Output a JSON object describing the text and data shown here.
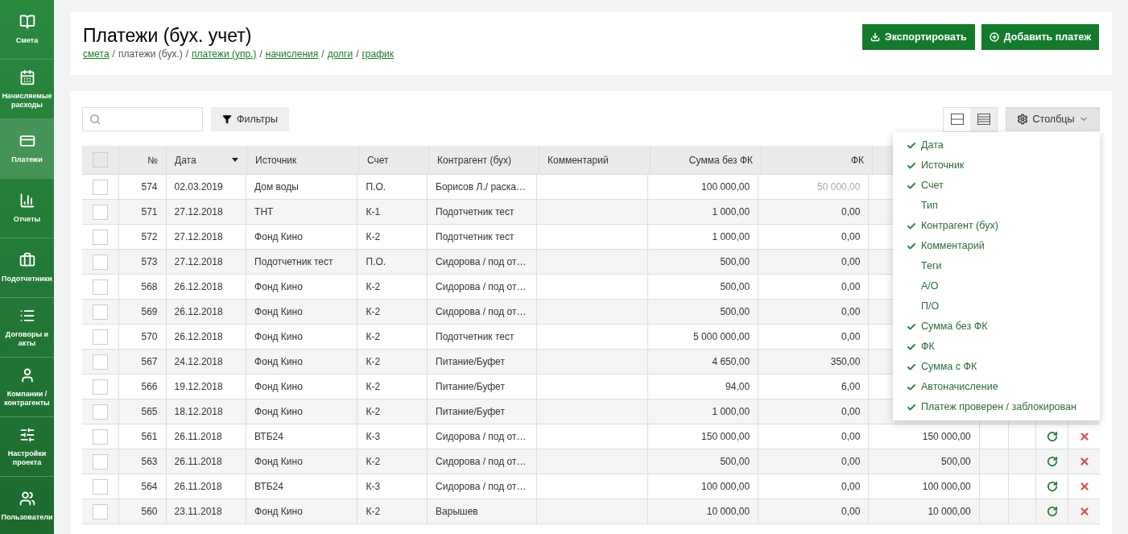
{
  "sidebar": {
    "items": [
      {
        "label": "Смета",
        "selected": false
      },
      {
        "label": "Начисляемые расходы",
        "selected": false
      },
      {
        "label": "Платежи",
        "selected": true
      },
      {
        "label": "Отчеты",
        "selected": false
      },
      {
        "label": "Подотчетники",
        "selected": false
      },
      {
        "label": "Договоры и акты",
        "selected": false
      },
      {
        "label": "Компании / контрагенты",
        "selected": false
      },
      {
        "label": "Настройки проекта",
        "selected": false
      },
      {
        "label": "Пользователи",
        "selected": false
      }
    ]
  },
  "header": {
    "title": "Платежи (бух. учет)",
    "breadcrumbs": [
      {
        "kind": "link",
        "label": "смета"
      },
      {
        "kind": "separator",
        "label": "/"
      },
      {
        "kind": "current",
        "label": "платежи (бух.)"
      },
      {
        "kind": "separator",
        "label": "/"
      },
      {
        "kind": "link",
        "label": "платежи (упр.)"
      },
      {
        "kind": "separator",
        "label": "/"
      },
      {
        "kind": "link",
        "label": "начисления"
      },
      {
        "kind": "separator",
        "label": "/"
      },
      {
        "kind": "link",
        "label": "долги"
      },
      {
        "kind": "separator",
        "label": "/"
      },
      {
        "kind": "link",
        "label": "график"
      }
    ],
    "buttons": [
      {
        "label": "Экспортировать"
      },
      {
        "label": "Добавить платеж"
      }
    ]
  },
  "toolbar": {
    "filters_button": "Фильтры",
    "columns_button": "Столбцы"
  },
  "columns_menu": [
    {
      "label": "Дата",
      "checked": true
    },
    {
      "label": "Источник",
      "checked": true
    },
    {
      "label": "Счет",
      "checked": true
    },
    {
      "label": "Тип",
      "checked": false
    },
    {
      "label": "Контрагент (бух)",
      "checked": true
    },
    {
      "label": "Комментарий",
      "checked": true
    },
    {
      "label": "Теги",
      "checked": false
    },
    {
      "label": "А/О",
      "checked": false
    },
    {
      "label": "П/О",
      "checked": false
    },
    {
      "label": "Сумма без ФК",
      "checked": true
    },
    {
      "label": "ФК",
      "checked": true
    },
    {
      "label": "Сумма с ФК",
      "checked": true
    },
    {
      "label": "Автоначисление",
      "checked": true
    },
    {
      "label": "Платеж проверен / заблокирован",
      "checked": true
    }
  ],
  "table": {
    "select_all_checked": false,
    "columns": [
      "№",
      "Дата",
      "Источник",
      "Счет",
      "Контрагент (бух)",
      "Комментарий",
      "Сумма без ФК",
      "ФК"
    ],
    "rows": [
      {
        "checked": false,
        "num": "574",
        "date": "02.03.2019",
        "source": "Дом воды",
        "account": "П.О.",
        "counterparty": "Борисов Л./ раска…",
        "sum": "100 000,00",
        "fk": "50 000,00",
        "fk_muted": true
      },
      {
        "checked": false,
        "num": "571",
        "date": "27.12.2018",
        "source": "ТНТ",
        "account": "К-1",
        "counterparty": "Подотчетник тест",
        "sum": "1 000,00",
        "fk": "0,00",
        "fk_muted": false
      },
      {
        "checked": false,
        "num": "572",
        "date": "27.12.2018",
        "source": "Фонд Кино",
        "account": "К-2",
        "counterparty": "Подотчетник тест",
        "sum": "1 000,00",
        "fk": "0,00",
        "fk_muted": false
      },
      {
        "checked": false,
        "num": "573",
        "date": "27.12.2018",
        "source": "Подотчетник тест",
        "account": "П.О.",
        "counterparty": "Сидорова / под от…",
        "sum": "500,00",
        "fk": "0,00",
        "fk_muted": false
      },
      {
        "checked": false,
        "num": "568",
        "date": "26.12.2018",
        "source": "Фонд Кино",
        "account": "К-2",
        "counterparty": "Сидорова / под от…",
        "sum": "500,00",
        "fk": "0,00",
        "fk_muted": false
      },
      {
        "checked": false,
        "num": "569",
        "date": "26.12.2018",
        "source": "Фонд Кино",
        "account": "К-2",
        "counterparty": "Сидорова / под от…",
        "sum": "500,00",
        "fk": "0,00",
        "fk_muted": false
      },
      {
        "checked": false,
        "num": "570",
        "date": "26.12.2018",
        "source": "Фонд Кино",
        "account": "К-2",
        "counterparty": "Подотчетник тест",
        "sum": "5 000 000,00",
        "fk": "0,00",
        "fk_muted": false
      },
      {
        "checked": false,
        "num": "567",
        "date": "24.12.2018",
        "source": "Фонд Кино",
        "account": "К-2",
        "counterparty": "Питание/Буфет",
        "sum": "4 650,00",
        "fk": "350,00",
        "fk_muted": false
      },
      {
        "checked": false,
        "num": "566",
        "date": "19.12.2018",
        "source": "Фонд Кино",
        "account": "К-2",
        "counterparty": "Питание/Буфет",
        "sum": "94,00",
        "fk": "6,00",
        "fk_muted": false
      },
      {
        "checked": false,
        "num": "565",
        "date": "18.12.2018",
        "source": "Фонд Кино",
        "account": "К-2",
        "counterparty": "Питание/Буфет",
        "sum": "1 000,00",
        "fk": "0,00",
        "fk_muted": false
      },
      {
        "checked": false,
        "num": "561",
        "date": "26.11.2018",
        "source": "ВТБ24",
        "account": "К-3",
        "counterparty": "Сидорова / под от…",
        "sum": "150 000,00",
        "fk": "0,00",
        "fk_muted": false,
        "total": "150 000,00"
      },
      {
        "checked": false,
        "num": "563",
        "date": "26.11.2018",
        "source": "Фонд Кино",
        "account": "К-2",
        "counterparty": "Сидорова / под от…",
        "sum": "500,00",
        "fk": "0,00",
        "fk_muted": false,
        "total": "500,00"
      },
      {
        "checked": false,
        "num": "564",
        "date": "26.11.2018",
        "source": "ВТБ24",
        "account": "К-3",
        "counterparty": "Сидорова / под от…",
        "sum": "100 000,00",
        "fk": "0,00",
        "fk_muted": false,
        "total": "100 000,00"
      },
      {
        "checked": false,
        "num": "560",
        "date": "23.11.2018",
        "source": "Фонд Кино",
        "account": "К-2",
        "counterparty": "Варышев",
        "sum": "10 000,00",
        "fk": "0,00",
        "fk_muted": false,
        "total": "10 000,00"
      }
    ]
  }
}
